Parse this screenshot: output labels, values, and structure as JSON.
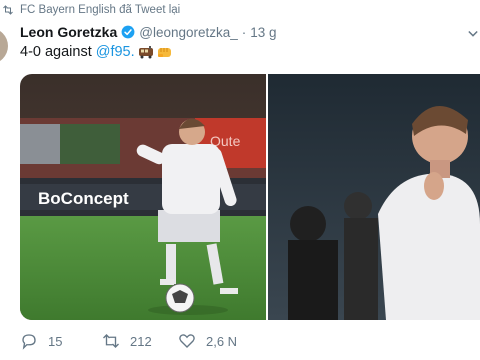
{
  "retweet_context": {
    "text": "FC Bayern English đã Tweet lại"
  },
  "tweet": {
    "author_name": "Leon Goretzka",
    "handle": "@leongoretzka_",
    "separator": "·",
    "time": "13 g",
    "text_prefix": "4-0 against",
    "mention": "@f95.",
    "emojis": [
      "train-emoji",
      "fist-emoji"
    ]
  },
  "media": {
    "left_photo": {
      "description_icon": "player-dribbling-photo",
      "ad_board_text": "BoConcept"
    },
    "right_photo": {
      "description_icon": "player-applauding-photo"
    }
  },
  "actions": {
    "reply_count": "15",
    "retweet_count": "212",
    "like_count": "2,6 N"
  },
  "colors": {
    "link": "#1b95e0",
    "muted": "#657786",
    "verified": "#1da1f2",
    "pitch": "#4f8a3a"
  }
}
